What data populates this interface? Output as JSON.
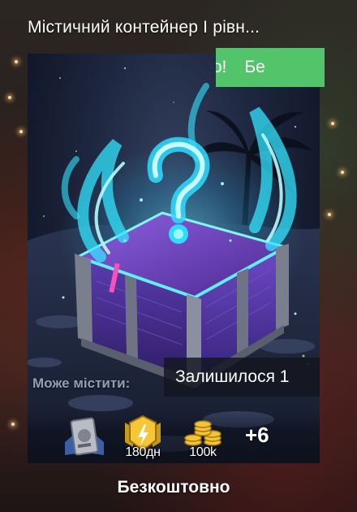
{
  "container": {
    "title": "Містичний контейнер I рівн...",
    "promo_text": "товно!",
    "promo_text_next": "Бе",
    "contains_label": "Може містити:",
    "remaining_label": "Залишилося 1",
    "price_label": "Безкоштовно"
  },
  "rewards": [
    {
      "icon": "silver-card-icon",
      "caption": ""
    },
    {
      "icon": "premium-badge-icon",
      "caption": "180дн"
    },
    {
      "icon": "gold-coins-icon",
      "caption": "100k"
    }
  ],
  "more_rewards": "+6",
  "colors": {
    "promo_green": "#52c46a",
    "glow_cyan": "#33e4ff",
    "chest_purple": "#6a3fc0"
  }
}
